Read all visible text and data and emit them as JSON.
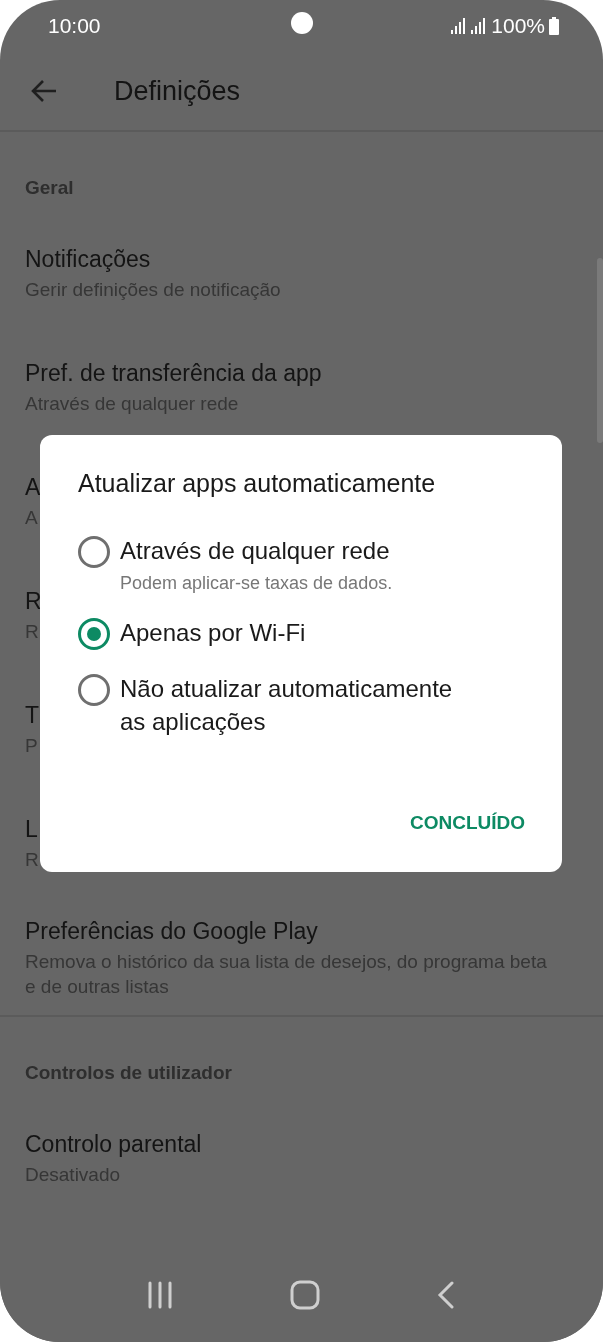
{
  "status_bar": {
    "time": "10:00",
    "battery": "100%"
  },
  "app_bar": {
    "title": "Definições"
  },
  "sections": [
    {
      "header": "Geral",
      "items": [
        {
          "title": "Notificações",
          "subtitle": "Gerir definições de notificação"
        },
        {
          "title": "Pref. de transferência da app",
          "subtitle": "Através de qualquer rede"
        },
        {
          "title": "A",
          "subtitle": "A"
        },
        {
          "title": "R",
          "subtitle": "R"
        },
        {
          "title": "T",
          "subtitle": "P"
        },
        {
          "title": "L",
          "subtitle": "R"
        },
        {
          "title": "Preferências do Google Play",
          "subtitle": "Remova o histórico da sua lista de desejos, do programa beta e de outras listas"
        }
      ]
    },
    {
      "header": "Controlos de utilizador",
      "items": [
        {
          "title": "Controlo parental",
          "subtitle": "Desativado"
        }
      ]
    }
  ],
  "dialog": {
    "title": "Atualizar apps automaticamente",
    "options": [
      {
        "label": "Através de qualquer rede",
        "description": "Podem aplicar-se taxas de dados.",
        "selected": false
      },
      {
        "label": "Apenas por Wi-Fi",
        "selected": true
      },
      {
        "label": "Não atualizar automaticamente as aplicações",
        "selected": false
      }
    ],
    "button": "CONCLUÍDO"
  }
}
